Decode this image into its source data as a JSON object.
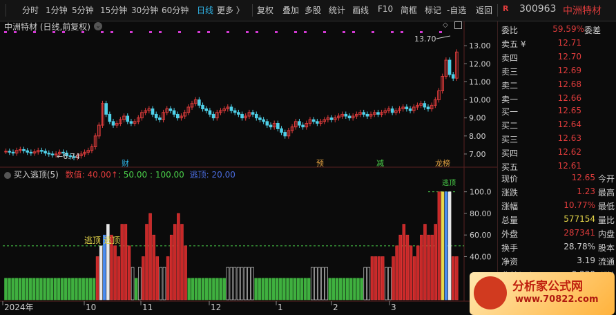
{
  "toolbar": {
    "items": [
      "分时",
      "1分钟",
      "5分钟",
      "15分钟",
      "30分钟",
      "60分钟",
      "日线",
      "更多 〉",
      "复权",
      "叠加",
      "多股",
      "统计",
      "画线",
      "F10",
      "简框",
      "标记",
      "-自选",
      "返回"
    ],
    "stock_badge": "R",
    "stock_code": "300963",
    "stock_name": "中洲特材"
  },
  "main_chart": {
    "title": "中洲特材 (日线,前复权)",
    "high_label": "13.70",
    "low_label": "6.74",
    "event_labels": [
      "财",
      "预",
      "减",
      "龙榜"
    ],
    "yticks": [
      "13.00",
      "12.00",
      "11.00",
      "10.00",
      "9.00",
      "8.00",
      "7.00"
    ]
  },
  "indicator": {
    "title": "买入逃顶(5)",
    "legend_value_label": "数值: 40.00",
    "legend_rest": ": 50.00 : 100.00",
    "legend_escape": "逃顶: 20.00",
    "flag_text": "逃顶 逃顶",
    "top_flag": "逃顶",
    "yticks": [
      "100.0",
      "80.00",
      "60.00",
      "40.00"
    ]
  },
  "xaxis": {
    "labels": [
      "2024年",
      "10",
      "11",
      "12",
      "1",
      "2",
      "3"
    ]
  },
  "orderbook": {
    "weibi_label": "委比",
    "weibi_value": "59.59%",
    "weicha_label": "委差",
    "asks": [
      {
        "label": "卖五 ¥",
        "price": "12.71"
      },
      {
        "label": "卖四",
        "price": "12.70"
      },
      {
        "label": "卖三",
        "price": "12.69"
      },
      {
        "label": "卖二",
        "price": "12.68"
      },
      {
        "label": "卖一",
        "price": "12.66"
      }
    ],
    "bids": [
      {
        "label": "买一",
        "price": "12.65"
      },
      {
        "label": "买二",
        "price": "12.64"
      },
      {
        "label": "买三",
        "price": "12.63"
      },
      {
        "label": "买四",
        "price": "12.62"
      },
      {
        "label": "买五",
        "price": "12.61"
      }
    ]
  },
  "quote": [
    {
      "label": "现价",
      "value": "12.65",
      "label2": "今开",
      "color": "#e03c3c"
    },
    {
      "label": "涨跌",
      "value": "1.23",
      "label2": "最高",
      "color": "#e03c3c"
    },
    {
      "label": "涨幅",
      "value": "10.77%",
      "label2": "最低",
      "color": "#e03c3c"
    },
    {
      "label": "总量",
      "value": "577154",
      "label2": "量比",
      "color": "#e8d84a"
    },
    {
      "label": "外盘",
      "value": "287341",
      "label2": "内盘",
      "color": "#e03c3c"
    },
    {
      "label": "换手",
      "value": "28.78%",
      "label2": "股本",
      "color": "#d0d0d0"
    },
    {
      "label": "净资",
      "value": "3.19",
      "label2": "流通",
      "color": "#d0d0d0"
    },
    {
      "label": "收益(三)",
      "value": "0.220",
      "label2": "PE(动)",
      "color": "#d0d0d0"
    }
  ],
  "watermark": {
    "line1": "分析家公式网",
    "line2": "www.70822.com"
  },
  "chart_data": [
    {
      "type": "candlestick",
      "title": "中洲特材 (日线,前复权)",
      "ylim": [
        6.5,
        14.0
      ],
      "x_labels": [
        "2024年",
        "10",
        "11",
        "12",
        "1",
        "2",
        "3"
      ],
      "annotations": {
        "max": 13.7,
        "min": 6.74
      },
      "closes": [
        7.15,
        7.1,
        7.05,
        7.2,
        7.25,
        7.18,
        7.1,
        7.05,
        7.12,
        7.2,
        7.15,
        7.05,
        7.0,
        6.95,
        7.0,
        7.1,
        7.05,
        6.9,
        6.85,
        6.8,
        6.9,
        7.0,
        7.1,
        7.2,
        7.4,
        8.0,
        8.6,
        9.8,
        9.2,
        8.8,
        8.6,
        8.7,
        8.9,
        9.1,
        8.8,
        8.7,
        8.8,
        9.0,
        9.3,
        9.4,
        9.5,
        9.2,
        9.0,
        8.9,
        9.3,
        9.5,
        9.4,
        9.2,
        9.0,
        9.1,
        9.3,
        9.6,
        9.8,
        10.0,
        9.7,
        9.5,
        9.4,
        9.2,
        9.0,
        9.3,
        9.4,
        9.5,
        9.6,
        9.4,
        9.3,
        9.2,
        9.0,
        9.1,
        9.3,
        9.2,
        9.0,
        8.9,
        8.8,
        8.6,
        8.5,
        8.7,
        8.4,
        8.2,
        8.0,
        8.3,
        8.5,
        8.8,
        8.6,
        8.5,
        8.7,
        8.9,
        8.8,
        8.7,
        8.8,
        8.9,
        9.0,
        8.9,
        9.0,
        9.1,
        9.2,
        9.1,
        9.0,
        9.1,
        9.2,
        9.3,
        9.2,
        9.1,
        9.2,
        9.3,
        9.2,
        9.3,
        9.4,
        9.5,
        9.3,
        9.4,
        9.5,
        9.6,
        9.5,
        9.4,
        9.6,
        9.7,
        9.8,
        9.6,
        9.5,
        9.7,
        10.0,
        10.5,
        11.3,
        12.2,
        11.4,
        11.2,
        12.65
      ]
    },
    {
      "type": "bar",
      "title": "买入逃顶(5)",
      "ylim": [
        0,
        110
      ],
      "reference_lines": [
        50,
        100
      ],
      "values": [
        20,
        20,
        20,
        20,
        20,
        20,
        20,
        20,
        20,
        20,
        20,
        20,
        20,
        20,
        20,
        20,
        20,
        20,
        20,
        20,
        20,
        20,
        20,
        20,
        20,
        20,
        40,
        50,
        60,
        70,
        60,
        50,
        40,
        70,
        70,
        50,
        30,
        20,
        30,
        40,
        70,
        80,
        60,
        40,
        30,
        30,
        40,
        60,
        70,
        80,
        70,
        50,
        20,
        20,
        20,
        20,
        20,
        20,
        20,
        20,
        20,
        20,
        20,
        30,
        30,
        30,
        30,
        30,
        30,
        30,
        30,
        20,
        20,
        20,
        20,
        20,
        20,
        20,
        20,
        20,
        20,
        20,
        20,
        20,
        20,
        20,
        20,
        30,
        30,
        30,
        30,
        30,
        20,
        20,
        20,
        20,
        20,
        20,
        20,
        20,
        20,
        20,
        30,
        30,
        40,
        40,
        40,
        40,
        30,
        30,
        40,
        50,
        60,
        70,
        60,
        50,
        40,
        50,
        60,
        70,
        60,
        60,
        70,
        100,
        100,
        100,
        100,
        40,
        40
      ]
    }
  ]
}
